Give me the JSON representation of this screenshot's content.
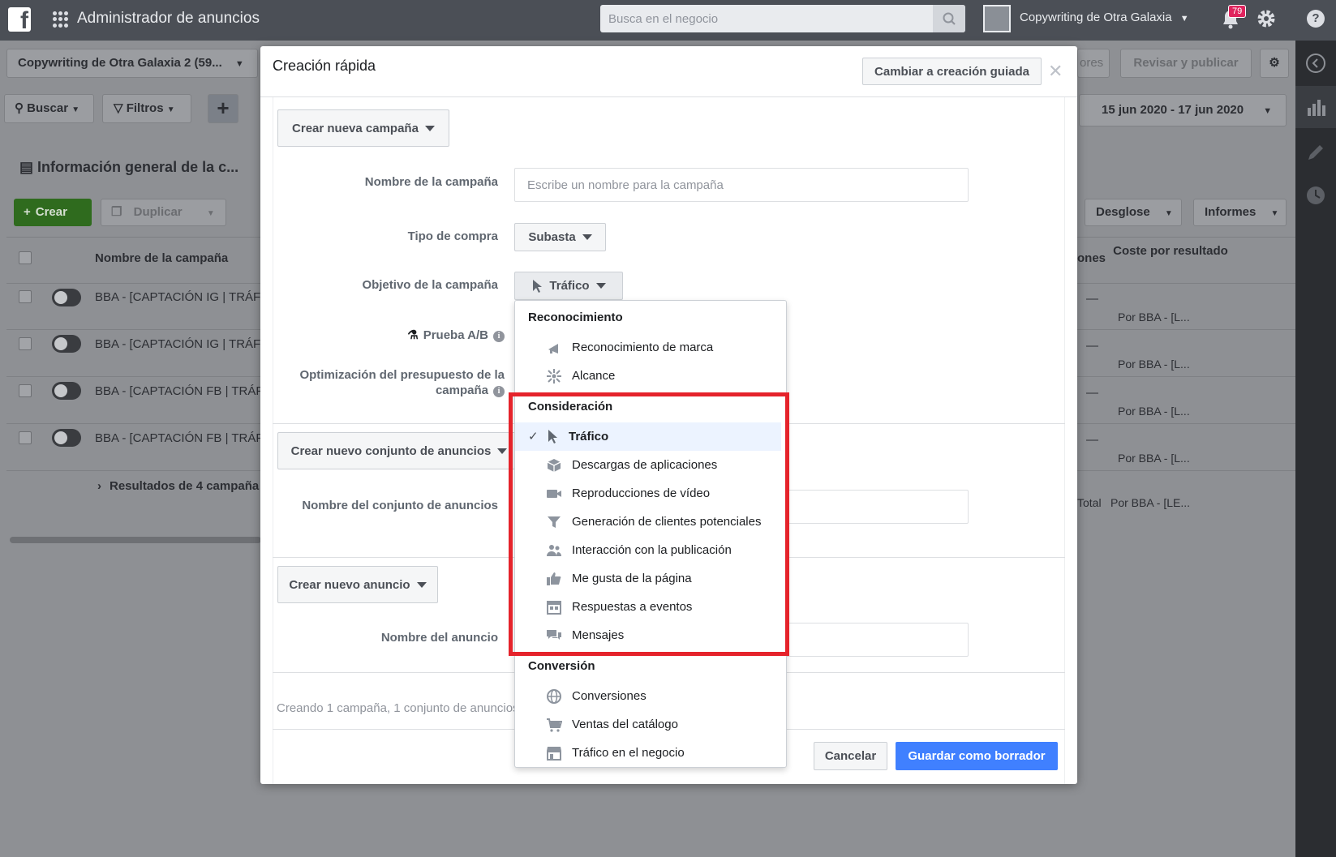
{
  "topbar": {
    "app_title": "Administrador de anuncios",
    "search_placeholder": "Busca en el negocio",
    "account_name": "Copywriting de Otra Galaxia",
    "notification_count": "79"
  },
  "background": {
    "account_selector": "Copywriting de Otra Galaxia 2 (59...",
    "buscar": "Buscar",
    "filtros": "Filtros",
    "date_range": "15 jun 2020 - 17 jun 2020",
    "review_label": "Revisar y publicar",
    "errors_label": "ores",
    "overview_title": "Información general de la c...",
    "crear": "Crear",
    "duplicar": "Duplicar",
    "desglose": "Desglose",
    "informes": "Informes",
    "col_name": "Nombre de la campaña",
    "col_results_partial": "ones",
    "col_cost": "Coste por resultado",
    "rows": [
      {
        "name": "BBA - [CAPTACIÓN IG | TRÁF",
        "cost_dash": "—",
        "cost_label": "Por BBA - [L..."
      },
      {
        "name": "BBA - [CAPTACIÓN IG | TRÁF",
        "cost_dash": "—",
        "cost_label": "Por BBA - [L..."
      },
      {
        "name": "BBA - [CAPTACIÓN FB | TRÁF",
        "cost_dash": "—",
        "cost_label": "Por BBA - [L..."
      },
      {
        "name": "BBA - [CAPTACIÓN FB | TRÁF",
        "cost_dash": "—",
        "cost_label": "Por BBA - [L..."
      }
    ],
    "results_summary": "Resultados de 4 campaña",
    "total_label": "Total",
    "total_cost_label": "Por BBA - [LE..."
  },
  "modal": {
    "title": "Creación rápida",
    "guided_button": "Cambiar a creación guiada",
    "new_campaign": "Crear nueva campaña",
    "campaign_name_label": "Nombre de la campaña",
    "campaign_name_placeholder": "Escribe un nombre para la campaña",
    "buy_type_label": "Tipo de compra",
    "buy_type_value": "Subasta",
    "objective_label": "Objetivo de la campaña",
    "objective_value": "Tráfico",
    "ab_test_label": "Prueba A/B",
    "budget_opt_label_1": "Optimización del presupuesto de la",
    "budget_opt_label_2": "campaña",
    "new_adset": "Crear nuevo conjunto de anuncios",
    "adset_name_label": "Nombre del conjunto de anuncios",
    "new_ad": "Crear nuevo anuncio",
    "ad_name_label": "Nombre del anuncio",
    "footer_note": "Creando 1 campaña, 1 conjunto de anuncios",
    "cancel": "Cancelar",
    "save_draft": "Guardar como borrador"
  },
  "dropdown": {
    "groups": [
      {
        "title": "Reconocimiento",
        "items": [
          {
            "label": "Reconocimiento de marca",
            "icon": "megaphone-icon"
          },
          {
            "label": "Alcance",
            "icon": "reach-icon"
          }
        ]
      },
      {
        "title": "Consideración",
        "items": [
          {
            "label": "Tráfico",
            "icon": "cursor-icon",
            "selected": true
          },
          {
            "label": "Descargas de aplicaciones",
            "icon": "box-icon"
          },
          {
            "label": "Reproducciones de vídeo",
            "icon": "video-camera-icon"
          },
          {
            "label": "Generación de clientes potenciales",
            "icon": "funnel-icon"
          },
          {
            "label": "Interacción con la publicación",
            "icon": "people-icon"
          },
          {
            "label": "Me gusta de la página",
            "icon": "thumbs-up-icon"
          },
          {
            "label": "Respuestas a eventos",
            "icon": "calendar-icon"
          },
          {
            "label": "Mensajes",
            "icon": "chat-bubbles-icon"
          }
        ]
      },
      {
        "title": "Conversión",
        "items": [
          {
            "label": "Conversiones",
            "icon": "globe-icon"
          },
          {
            "label": "Ventas del catálogo",
            "icon": "cart-icon"
          },
          {
            "label": "Tráfico en el negocio",
            "icon": "store-icon"
          }
        ]
      }
    ]
  },
  "colors": {
    "topbar": "#4b4f56",
    "primary": "#4080ff",
    "highlight": "#e5232b",
    "create_green": "#42b72a"
  }
}
